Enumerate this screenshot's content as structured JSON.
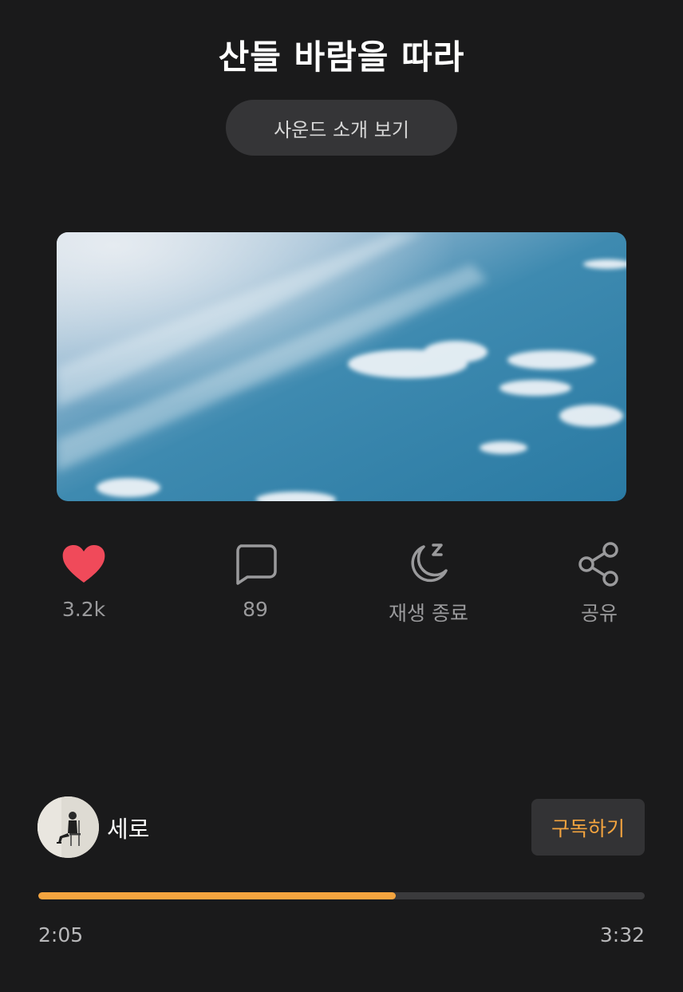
{
  "title": "산들 바람을 따라",
  "intro_button": "사운드 소개 보기",
  "cover": {
    "description": "blue sky with wispy clouds"
  },
  "actions": [
    {
      "icon": "heart-icon",
      "label": "3.2k",
      "color": "#f04a5a"
    },
    {
      "icon": "comment-icon",
      "label": "89",
      "color": "#9a9a9c"
    },
    {
      "icon": "sleep-timer-icon",
      "label": "재생 종료",
      "color": "#9a9a9c"
    },
    {
      "icon": "share-icon",
      "label": "공유",
      "color": "#9a9a9c"
    }
  ],
  "author": {
    "name": "세로"
  },
  "subscribe_button": "구독하기",
  "player": {
    "current_time": "2:05",
    "total_time": "3:32",
    "progress": 0.59
  },
  "colors": {
    "background": "#1a1a1b",
    "accent": "#f3a43f",
    "heart": "#f04a5a"
  }
}
